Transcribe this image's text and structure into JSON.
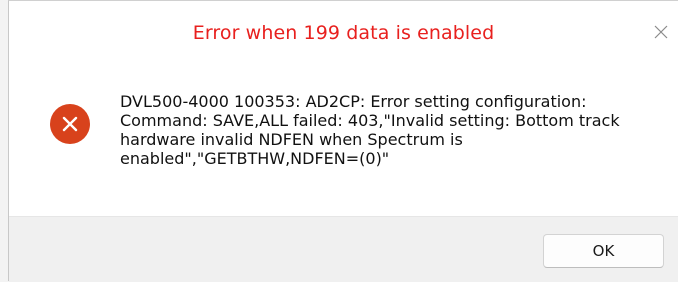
{
  "dialog": {
    "title": "Error when 199 data is enabled",
    "title_color": "#e8201e",
    "close_icon": "close-icon",
    "icon": "error-icon",
    "icon_color": "#d8421c",
    "message": "DVL500-4000 100353: AD2CP: Error setting configuration:\nCommand: SAVE,ALL failed: 403,\"Invalid setting: Bottom track\nhardware invalid NDFEN when Spectrum is\nenabled\",\"GETBTHW,NDFEN=(0)\"",
    "ok_label": "OK"
  }
}
